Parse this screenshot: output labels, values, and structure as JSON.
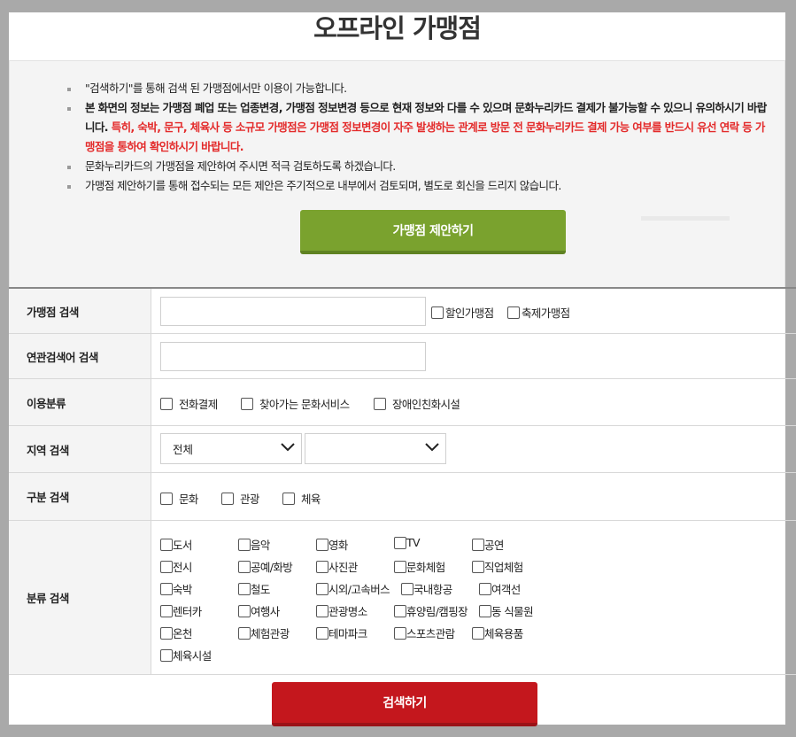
{
  "page_title": "오프라인 가맹점",
  "notices": [
    {
      "text": "\"검색하기\"를 통해 검색 된 가맹점에서만 이용이 가능합니다.",
      "bold": false
    },
    {
      "text": "본 화면의 정보는 가맹점 폐업 또는 업종변경, 가맹점 정보변경 등으로 현재 정보와 다를 수 있으며 문화누리카드 결제가 불가능할 수 있으니 유의하시기 바랍니다.",
      "red": " 특히, 숙박, 문구, 체육사 등 소규모 가맹점은 가맹점 정보변경이 자주 발생하는 관계로 방문 전 문화누리카드 결제 가능 여부를 반드시 유선 연락 등 가맹점을 통하여 확인하시기 바랍니다.",
      "bold": true
    },
    {
      "text": "문화누리카드의 가맹점을 제안하여 주시면 적극 검토하도록 하겠습니다.",
      "bold": false
    },
    {
      "text": "가맹점 제안하기를 통해 접수되는 모든 제안은 주기적으로 내부에서 검토되며, 별도로 회신을 드리지 않습니다.",
      "bold": false
    }
  ],
  "suggest_button": "가맹점 제안하기",
  "form": {
    "store_search": {
      "label": "가맹점 검색",
      "value": "",
      "options": [
        "할인가맹점",
        "축제가맹점"
      ]
    },
    "related_search": {
      "label": "연관검색어 검색",
      "value": ""
    },
    "usage_category": {
      "label": "이용분류",
      "options": [
        "전화결제",
        "찾아가는 문화서비스",
        "장애인친화시설"
      ]
    },
    "region": {
      "label": "지역 검색",
      "select1": "전체",
      "select2": ""
    },
    "division": {
      "label": "구분 검색",
      "options": [
        "문화",
        "관광",
        "체육"
      ]
    },
    "classification": {
      "label": "분류 검색",
      "options": [
        "도서",
        "음악",
        "영화",
        "TV",
        "공연",
        "전시",
        "공예/화방",
        "사진관",
        "문화체험",
        "직업체험",
        "숙박",
        "철도",
        "시외/고속버스",
        "국내항공",
        "여객선",
        "렌터카",
        "여행사",
        "관광명소",
        "휴양림/캠핑장",
        "동 식물원",
        "온천",
        "체험관광",
        "테마파크",
        "스포츠관람",
        "체육용품",
        "체육시설"
      ]
    }
  },
  "search_button": "검색하기",
  "colors": {
    "suggest": "#7aa22e",
    "search": "#c4171d",
    "notice_red": "#e32a2a"
  }
}
